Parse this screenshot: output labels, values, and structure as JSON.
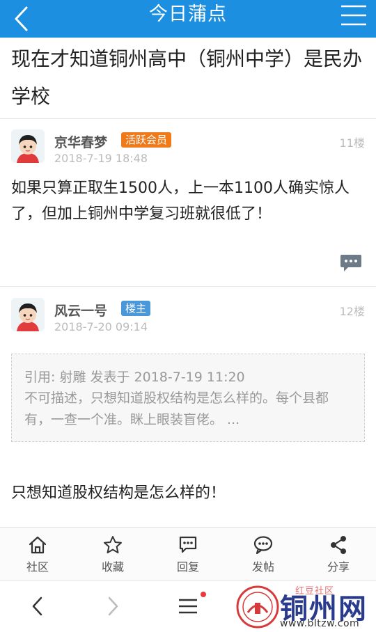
{
  "header": {
    "title": "今日蒲点"
  },
  "thread": {
    "title": "现在才知道铜州高中（铜州中学）是民办学校"
  },
  "posts": [
    {
      "username": "京华春梦",
      "badge": "活跃会员",
      "time": "2018-7-19 18:48",
      "floor": "11楼",
      "content": "如果只算正取生1500人，上一本1100人确实惊人了，但加上铜州中学复习班就很低了！"
    },
    {
      "username": "风云一号",
      "badge": "楼主",
      "time": "2018-7-20 09:14",
      "floor": "12楼",
      "quote": {
        "header": "引用: 射雕 发表于 2018-7-19 11:20",
        "text": "不可描述，只想知道股权结构是怎么样的。每个县都有，一查一个准。眯上眼装盲佬。 ..."
      },
      "content": "只想知道股权结构是怎么样的！"
    }
  ],
  "tabbar": {
    "items": [
      {
        "label": "社区",
        "icon": "home-icon"
      },
      {
        "label": "收藏",
        "icon": "star-icon"
      },
      {
        "label": "回复",
        "icon": "reply-icon"
      },
      {
        "label": "发帖",
        "icon": "post-icon"
      },
      {
        "label": "分享",
        "icon": "share-icon"
      }
    ]
  },
  "watermark": {
    "brand": "铜州网",
    "sub": "红豆社区",
    "url": "www.bltzw.com"
  },
  "colors": {
    "header_bg": "#1d8fe0",
    "badge_active": "#f07a1a",
    "badge_owner": "#4a97d9"
  }
}
